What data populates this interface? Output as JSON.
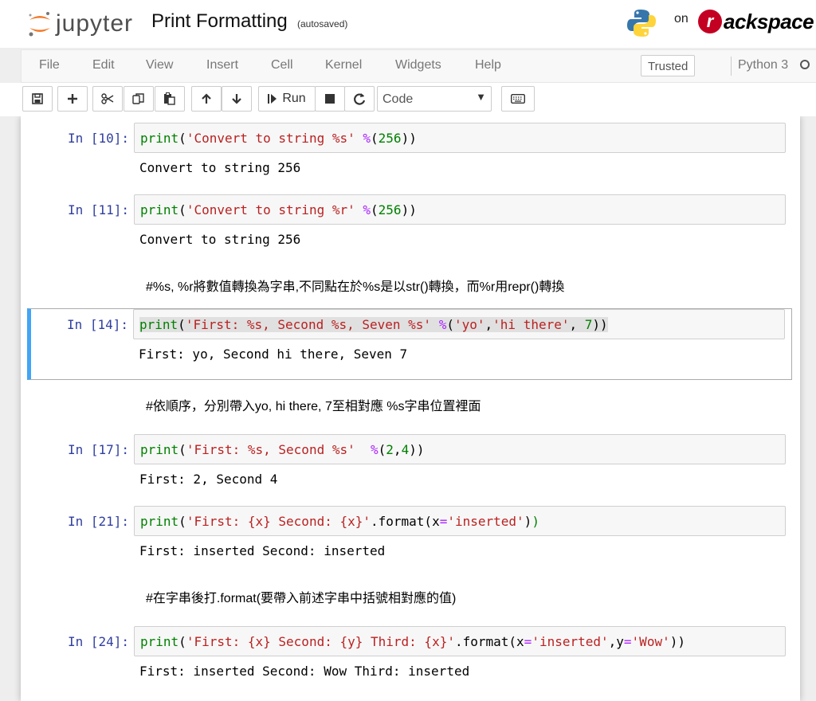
{
  "header": {
    "logo_text": "jupyter",
    "notebook_title": "Print Formatting",
    "autosave": "(autosaved)",
    "on_text": "on",
    "rackspace_r": "r",
    "rackspace_text": "ackspace"
  },
  "menu": {
    "items": [
      "File",
      "Edit",
      "View",
      "Insert",
      "Cell",
      "Kernel",
      "Widgets",
      "Help"
    ],
    "trusted": "Trusted",
    "kernel_name": "Python 3"
  },
  "toolbar": {
    "run_label": "Run",
    "cell_type": "Code",
    "icons": [
      "save-icon",
      "plus-icon",
      "cut-icon",
      "copy-icon",
      "paste-icon",
      "arrow-up-icon",
      "arrow-down-icon",
      "run-icon",
      "stop-icon",
      "restart-icon",
      "keyboard-icon"
    ]
  },
  "cells": [
    {
      "type": "code",
      "prompt": "In [10]:",
      "tokens": [
        [
          "print",
          "kw"
        ],
        [
          "(",
          ""
        ],
        [
          "'Convert to string %s'",
          "st"
        ],
        [
          " ",
          ""
        ],
        [
          "%",
          "op"
        ],
        [
          "(",
          ""
        ],
        [
          "256",
          "nm"
        ],
        [
          "))",
          ""
        ]
      ],
      "output": "Convert to string 256"
    },
    {
      "type": "code",
      "prompt": "In [11]:",
      "tokens": [
        [
          "print",
          "kw"
        ],
        [
          "(",
          ""
        ],
        [
          "'Convert to string %r'",
          "st"
        ],
        [
          " ",
          ""
        ],
        [
          "%",
          "op"
        ],
        [
          "(",
          ""
        ],
        [
          "256",
          "nm"
        ],
        [
          "))",
          ""
        ]
      ],
      "output": "Convert to string 256"
    },
    {
      "type": "markdown",
      "text": "#%s, %r將數值轉換為字串,不同點在於%s是以str()轉換，而%r用repr()轉換"
    },
    {
      "type": "code",
      "selected": true,
      "prompt": "In [14]:",
      "tokens": [
        [
          "print",
          "kw"
        ],
        [
          "(",
          ""
        ],
        [
          "'First: %s, Second %s, Seven %s'",
          "st"
        ],
        [
          " ",
          ""
        ],
        [
          "%",
          "op"
        ],
        [
          "(",
          ""
        ],
        [
          "'yo'",
          "st"
        ],
        [
          ",",
          ""
        ],
        [
          "'hi there'",
          "st"
        ],
        [
          ", ",
          ""
        ],
        [
          "7",
          "nm"
        ],
        [
          "))",
          ""
        ]
      ],
      "output": "First: yo, Second hi there, Seven 7"
    },
    {
      "type": "markdown",
      "text": "#依順序，分別帶入yo, hi there, 7至相對應 %s字串位置裡面"
    },
    {
      "type": "code",
      "prompt": "In [17]:",
      "tokens": [
        [
          "print",
          "kw"
        ],
        [
          "(",
          ""
        ],
        [
          "'First: %s, Second %s'",
          "st"
        ],
        [
          "  ",
          ""
        ],
        [
          "%",
          "op"
        ],
        [
          "(",
          ""
        ],
        [
          "2",
          "nm"
        ],
        [
          ",",
          ""
        ],
        [
          "4",
          "nm"
        ],
        [
          "))",
          ""
        ]
      ],
      "output": "First: 2, Second 4"
    },
    {
      "type": "code",
      "prompt": "In [21]:",
      "tokens": [
        [
          "print",
          "kw"
        ],
        [
          "(",
          ""
        ],
        [
          "'First: {x} Second: {x}'",
          "st"
        ],
        [
          ".format(x",
          ""
        ],
        [
          "=",
          "op"
        ],
        [
          "'inserted'",
          "st"
        ],
        [
          ")",
          ""
        ],
        [
          ")",
          "kw"
        ]
      ],
      "output": "First: inserted Second: inserted"
    },
    {
      "type": "markdown",
      "text": "#在字串後打.format(要帶入前述字串中括號相對應的值)"
    },
    {
      "type": "code",
      "prompt": "In [24]:",
      "tokens": [
        [
          "print",
          "kw"
        ],
        [
          "(",
          ""
        ],
        [
          "'First: {x} Second: {y} Third: {x}'",
          "st"
        ],
        [
          ".format(x",
          ""
        ],
        [
          "=",
          "op"
        ],
        [
          "'inserted'",
          "st"
        ],
        [
          ",y",
          ""
        ],
        [
          "=",
          "op"
        ],
        [
          "'Wow'",
          "st"
        ],
        [
          "))",
          ""
        ]
      ],
      "output": "First: inserted Second: Wow Third: inserted"
    }
  ]
}
